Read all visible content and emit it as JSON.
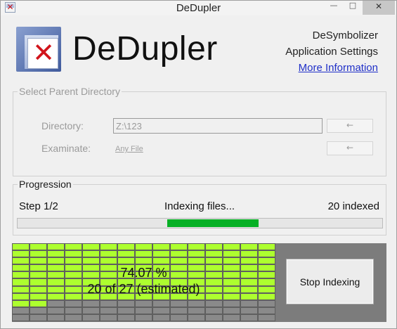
{
  "window": {
    "title": "DeDupler",
    "controls": {
      "minimize": "—",
      "maximize": "□",
      "close": "✕"
    },
    "icon": "dedupler-x-icon"
  },
  "header": {
    "app_name": "DeDupler",
    "logo_icon": "red-x-document-icon",
    "links": {
      "desymbolizer": "DeSymbolizer",
      "app_settings": "Application Settings",
      "more_info": "More Information"
    }
  },
  "parent_directory": {
    "group_title": "Select Parent Directory",
    "directory_label": "Directory:",
    "directory_value": "Z:\\123",
    "examinate_label": "Examinate:",
    "examinate_value": "Any File",
    "arrow_label": "←"
  },
  "progression": {
    "group_title": "Progression",
    "step": "Step 1/2",
    "status": "Indexing files...",
    "indexed": "20 indexed",
    "bar_fill_start_fraction": 0.41,
    "bar_fill_end_fraction": 0.66,
    "bar_color": "#06b025"
  },
  "grid": {
    "percent_text": "74.07 %",
    "estimate_text": "20 of 27 (estimated)",
    "fraction_complete": 0.7407,
    "done_color": "#adff2f",
    "empty_color": "#8a8a8a",
    "stop_label": "Stop Indexing"
  }
}
